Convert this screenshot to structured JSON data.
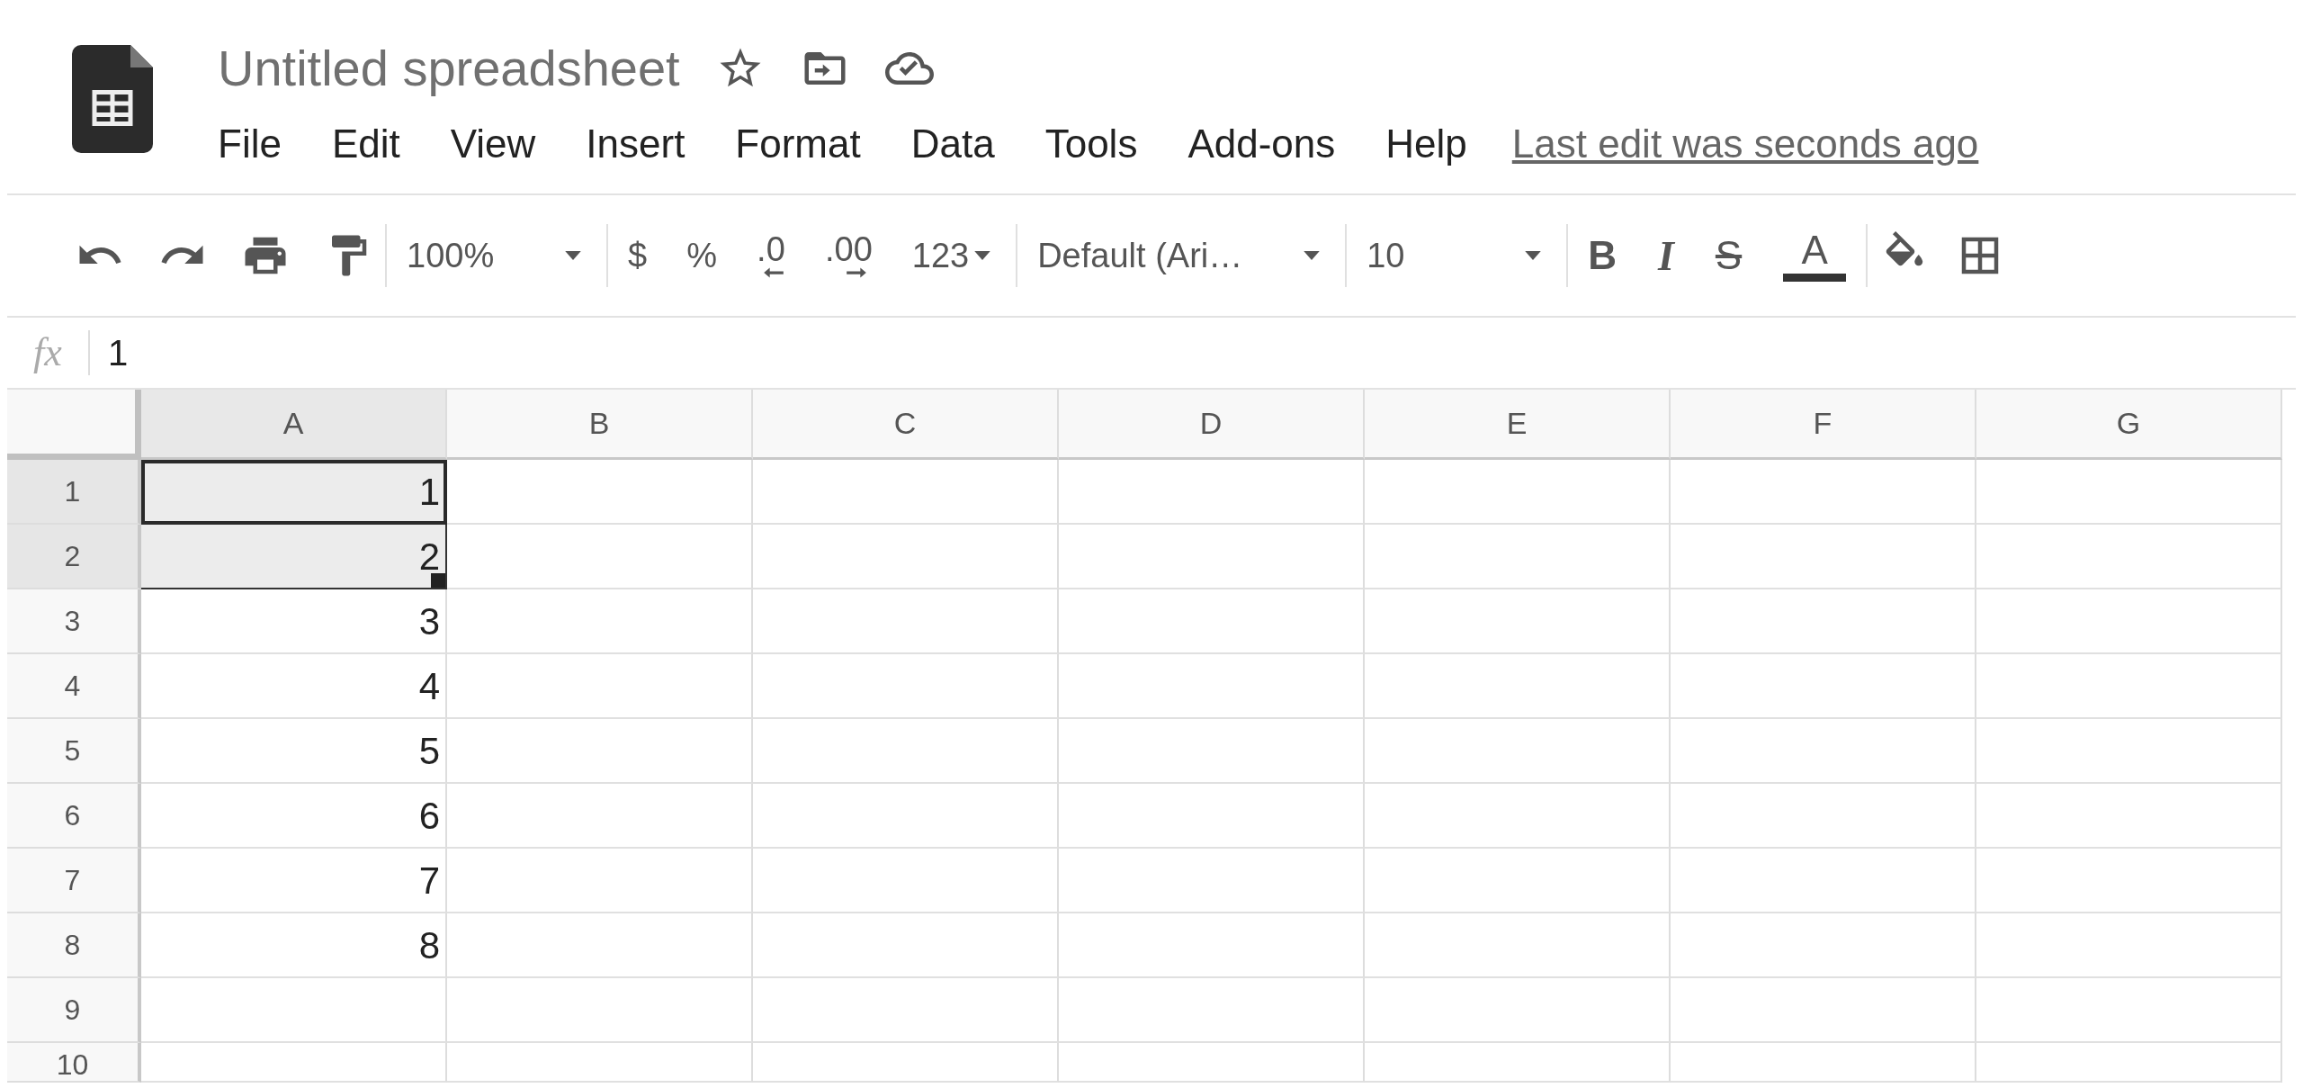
{
  "header": {
    "title": "Untitled spreadsheet",
    "title_icons": [
      {
        "kind": "star"
      },
      {
        "kind": "move"
      },
      {
        "kind": "cloud"
      }
    ]
  },
  "menu": [
    "File",
    "Edit",
    "View",
    "Insert",
    "Format",
    "Data",
    "Tools",
    "Add-ons",
    "Help"
  ],
  "last_edit": "Last edit was seconds ago",
  "toolbar": [
    [
      {
        "kind": "undo"
      },
      {
        "kind": "redo"
      },
      {
        "kind": "print"
      },
      {
        "kind": "paint"
      }
    ],
    [
      {
        "kind": "dropdown",
        "label": "100%"
      }
    ],
    [
      {
        "kind": "text",
        "label": "$"
      },
      {
        "kind": "text",
        "label": "%"
      },
      {
        "kind": "decrease_decimal",
        "label": ".0"
      },
      {
        "kind": "increase_decimal",
        "label": ".00"
      },
      {
        "kind": "menu_text",
        "label": "123"
      }
    ],
    [
      {
        "kind": "font_dropdown",
        "label": "Default (Ari…"
      }
    ],
    [
      {
        "kind": "dropdown",
        "label": "10"
      }
    ],
    [
      {
        "kind": "bold",
        "label": "B"
      },
      {
        "kind": "italic",
        "label": "I"
      },
      {
        "kind": "strike",
        "label": "S"
      },
      {
        "kind": "text_color",
        "label": "A"
      }
    ],
    [
      {
        "kind": "fill"
      },
      {
        "kind": "borders"
      }
    ]
  ],
  "formula_bar": {
    "label": "fx",
    "value": "1"
  },
  "grid": {
    "columns": [
      {
        "label": "A",
        "selected": true
      },
      {
        "label": "B",
        "selected": false
      },
      {
        "label": "C",
        "selected": false
      },
      {
        "label": "D",
        "selected": false
      },
      {
        "label": "E",
        "selected": false
      },
      {
        "label": "F",
        "selected": false
      },
      {
        "label": "G",
        "selected": false
      }
    ],
    "rows": [
      {
        "label": "1",
        "selected": true,
        "active": true,
        "value": "1"
      },
      {
        "label": "2",
        "selected": true,
        "active": false,
        "value": "2"
      },
      {
        "label": "3",
        "selected": false,
        "active": false,
        "value": "3"
      },
      {
        "label": "4",
        "selected": false,
        "active": false,
        "value": "4"
      },
      {
        "label": "5",
        "selected": false,
        "active": false,
        "value": "5"
      },
      {
        "label": "6",
        "selected": false,
        "active": false,
        "value": "6"
      },
      {
        "label": "7",
        "selected": false,
        "active": false,
        "value": "7"
      },
      {
        "label": "8",
        "selected": false,
        "active": false,
        "value": "8"
      },
      {
        "label": "9",
        "selected": false,
        "active": false
      },
      {
        "label": "10",
        "selected": false,
        "active": false
      }
    ]
  }
}
